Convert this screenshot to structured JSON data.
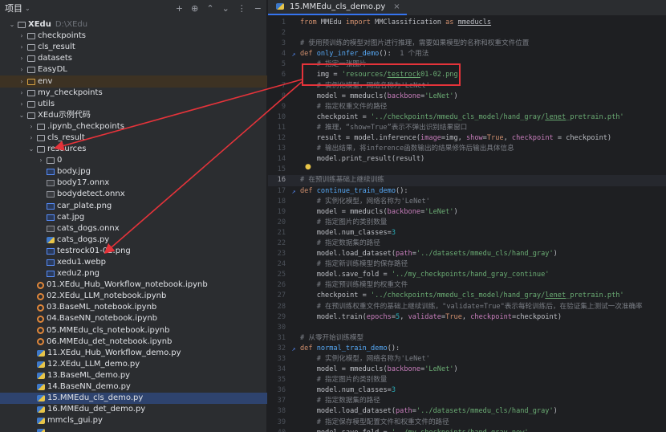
{
  "project": {
    "title": "项目",
    "tree": [
      {
        "name": "XEdu",
        "sub": "D:\\XEdu",
        "depth": 0,
        "type": "folder",
        "chev": "⌄",
        "bold": true
      },
      {
        "name": "checkpoints",
        "depth": 1,
        "type": "folder",
        "chev": "›"
      },
      {
        "name": "cls_result",
        "depth": 1,
        "type": "folder",
        "chev": "›"
      },
      {
        "name": "datasets",
        "depth": 1,
        "type": "folder",
        "chev": "›"
      },
      {
        "name": "EasyDL",
        "depth": 1,
        "type": "folder",
        "chev": "›"
      },
      {
        "name": "env",
        "depth": 1,
        "type": "folder-orange",
        "chev": "›",
        "env": true
      },
      {
        "name": "my_checkpoints",
        "depth": 1,
        "type": "folder",
        "chev": "›"
      },
      {
        "name": "utils",
        "depth": 1,
        "type": "folder",
        "chev": "›"
      },
      {
        "name": "XEdu示例代码",
        "depth": 1,
        "type": "folder",
        "chev": "⌄"
      },
      {
        "name": ".ipynb_checkpoints",
        "depth": 2,
        "type": "folder",
        "chev": "›"
      },
      {
        "name": "cls_result",
        "depth": 2,
        "type": "folder",
        "chev": "›"
      },
      {
        "name": "resources",
        "depth": 2,
        "type": "folder",
        "chev": "⌄"
      },
      {
        "name": "0",
        "depth": 3,
        "type": "folder",
        "chev": "›"
      },
      {
        "name": "body.jpg",
        "depth": 3,
        "type": "img",
        "chev": ""
      },
      {
        "name": "body17.onnx",
        "depth": 3,
        "type": "onnx",
        "chev": ""
      },
      {
        "name": "bodydetect.onnx",
        "depth": 3,
        "type": "onnx",
        "chev": ""
      },
      {
        "name": "car_plate.png",
        "depth": 3,
        "type": "img",
        "chev": ""
      },
      {
        "name": "cat.jpg",
        "depth": 3,
        "type": "img",
        "chev": ""
      },
      {
        "name": "cats_dogs.onnx",
        "depth": 3,
        "type": "onnx",
        "chev": ""
      },
      {
        "name": "cats_dogs.py",
        "depth": 3,
        "type": "py",
        "chev": ""
      },
      {
        "name": "testrock01-02.png",
        "depth": 3,
        "type": "img",
        "chev": ""
      },
      {
        "name": "xedu1.webp",
        "depth": 3,
        "type": "img",
        "chev": ""
      },
      {
        "name": "xedu2.png",
        "depth": 3,
        "type": "img",
        "chev": ""
      },
      {
        "name": "01.XEdu_Hub_Workflow_notebook.ipynb",
        "depth": 2,
        "type": "nb",
        "chev": ""
      },
      {
        "name": "02.XEdu_LLM_notebook.ipynb",
        "depth": 2,
        "type": "nb",
        "chev": ""
      },
      {
        "name": "03.BaseML_notebook.ipynb",
        "depth": 2,
        "type": "nb",
        "chev": ""
      },
      {
        "name": "04.BaseNN_notebook.ipynb",
        "depth": 2,
        "type": "nb",
        "chev": ""
      },
      {
        "name": "05.MMEdu_cls_notebook.ipynb",
        "depth": 2,
        "type": "nb",
        "chev": ""
      },
      {
        "name": "06.MMEdu_det_notebook.ipynb",
        "depth": 2,
        "type": "nb",
        "chev": ""
      },
      {
        "name": "11.XEdu_Hub_Workflow_demo.py",
        "depth": 2,
        "type": "py",
        "chev": ""
      },
      {
        "name": "12.XEdu_LLM_demo.py",
        "depth": 2,
        "type": "py",
        "chev": ""
      },
      {
        "name": "13.BaseML_demo.py",
        "depth": 2,
        "type": "py",
        "chev": ""
      },
      {
        "name": "14.BaseNN_demo.py",
        "depth": 2,
        "type": "py",
        "chev": ""
      },
      {
        "name": "15.MMEdu_cls_demo.py",
        "depth": 2,
        "type": "py",
        "chev": "",
        "selected": true
      },
      {
        "name": "16.MMEdu_det_demo.py",
        "depth": 2,
        "type": "py",
        "chev": ""
      },
      {
        "name": "mmcls_gui.py",
        "depth": 2,
        "type": "py",
        "chev": ""
      },
      {
        "name": "",
        "depth": 2,
        "type": "py",
        "chev": ""
      }
    ]
  },
  "editor": {
    "tab_label": "15.MMEdu_cls_demo.py",
    "tab_close": "×",
    "usage_hint": "1 个用法",
    "lines": [
      {
        "n": "1",
        "mark": "",
        "html": "<span class='kw'>from</span> MMEdu <span class='kw'>import</span> MMClassification <span class='kw'>as</span> <span class='u'>mmeducls</span>"
      },
      {
        "n": "2",
        "mark": "",
        "html": ""
      },
      {
        "n": "3",
        "mark": "",
        "html": "<span class='cm'># 使用预训练的模型对图片进行推理，需要如果模型的名称和权重文件位置</span>"
      },
      {
        "n": "4",
        "mark": "↗",
        "html": "<span class='kw'>def</span> <span class='fn'>only_infer_demo</span>():  <span class='hint' data-name='usage-hint' data-bind='editor.usage_hint' data-interactable='true'></span>"
      },
      {
        "n": "5",
        "mark": "",
        "html": "    <span class='cm'># 指定一张图片</span>"
      },
      {
        "n": "6",
        "mark": "",
        "html": "    img = <span class='str'>'resources/<span class=\"u\">testrock</span>01-02.png'</span>"
      },
      {
        "n": "7",
        "mark": "",
        "html": "    <span class='cm'># 实例化模型，网络名称为'LeNet'</span>"
      },
      {
        "n": "8",
        "mark": "",
        "html": "    model = mmeducls(<span class='prm'>backbone</span>=<span class='str'>'LeNet'</span>)"
      },
      {
        "n": "9",
        "mark": "",
        "html": "    <span class='cm'># 指定权重文件的路径</span>"
      },
      {
        "n": "10",
        "mark": "",
        "html": "    checkpoint = <span class='str'>'../checkpoints/mmedu_cls_model/hand_gray/<span class=\"u\">lenet</span>_pretrain.pth'</span>"
      },
      {
        "n": "11",
        "mark": "",
        "html": "    <span class='cm'># 推理，“show=True”表示不弹出识别结果窗口</span>"
      },
      {
        "n": "12",
        "mark": "",
        "html": "    result = model.inference(<span class='prm'>image</span>=img, <span class='prm'>show</span>=<span class='kw'>True</span>, <span class='prm'>checkpoint</span> = checkpoint)"
      },
      {
        "n": "13",
        "mark": "",
        "html": "    <span class='cm'># 输出结果，将inference函数输出的结果修饰后输出具体信息</span>"
      },
      {
        "n": "14",
        "mark": "",
        "html": "    model.print_result(result)"
      },
      {
        "n": "15",
        "mark": "",
        "html": ""
      },
      {
        "n": "16",
        "mark": "",
        "html": "<span class='cm'># 在预训练基础上继续训练</span>",
        "cur": true
      },
      {
        "n": "17",
        "mark": "↗",
        "html": "<span class='kw'>def</span> <span class='fn'>continue_train_demo</span>():"
      },
      {
        "n": "18",
        "mark": "",
        "html": "    <span class='cm'># 实例化模型，网络名称为'LeNet'</span>"
      },
      {
        "n": "19",
        "mark": "",
        "html": "    model = mmeducls(<span class='prm'>backbone</span>=<span class='str'>'LeNet'</span>)"
      },
      {
        "n": "20",
        "mark": "",
        "html": "    <span class='cm'># 指定图片的类别数量</span>"
      },
      {
        "n": "21",
        "mark": "",
        "html": "    model.num_classes=<span class='num'>3</span>"
      },
      {
        "n": "22",
        "mark": "",
        "html": "    <span class='cm'># 指定数据集的路径</span>"
      },
      {
        "n": "23",
        "mark": "",
        "html": "    model.load_dataset(<span class='prm'>path</span>=<span class='str'>'../datasets/mmedu_cls/hand_gray'</span>)"
      },
      {
        "n": "24",
        "mark": "",
        "html": "    <span class='cm'># 指定新训练模型的保存路径</span>"
      },
      {
        "n": "25",
        "mark": "",
        "html": "    model.save_fold = <span class='str'>'../my_checkpoints/hand_gray_continue'</span>"
      },
      {
        "n": "26",
        "mark": "",
        "html": "    <span class='cm'># 指定预训练模型的权重文件</span>"
      },
      {
        "n": "27",
        "mark": "",
        "html": "    checkpoint = <span class='str'>'../checkpoints/mmedu_cls_model/hand_gray/<span class=\"u\">lenet</span>_pretrain.pth'</span>"
      },
      {
        "n": "28",
        "mark": "",
        "html": "    <span class='cm'># 在预训练权重文件的基础上继续训练，\"validate=True\"表示每轮训练后，在验证集上测试一次准确率</span>"
      },
      {
        "n": "29",
        "mark": "",
        "html": "    model.train(<span class='prm'>epochs</span>=<span class='num'>5</span>, <span class='prm'>validate</span>=<span class='kw'>True</span>, <span class='prm'>checkpoint</span>=checkpoint)"
      },
      {
        "n": "30",
        "mark": "",
        "html": ""
      },
      {
        "n": "31",
        "mark": "",
        "html": "<span class='cm'># 从零开始训练模型</span>"
      },
      {
        "n": "32",
        "mark": "↗",
        "html": "<span class='kw'>def</span> <span class='fn'>normal_train_demo</span>():"
      },
      {
        "n": "33",
        "mark": "",
        "html": "    <span class='cm'># 实例化模型，网络名称为'LeNet'</span>"
      },
      {
        "n": "34",
        "mark": "",
        "html": "    model = mmeducls(<span class='prm'>backbone</span>=<span class='str'>'LeNet'</span>)"
      },
      {
        "n": "35",
        "mark": "",
        "html": "    <span class='cm'># 指定图片的类别数量</span>"
      },
      {
        "n": "36",
        "mark": "",
        "html": "    model.num_classes=<span class='num'>3</span>"
      },
      {
        "n": "37",
        "mark": "",
        "html": "    <span class='cm'># 指定数据集的路径</span>"
      },
      {
        "n": "38",
        "mark": "",
        "html": "    model.load_dataset(<span class='prm'>path</span>=<span class='str'>'../datasets/mmedu_cls/hand_gray'</span>)"
      },
      {
        "n": "39",
        "mark": "",
        "html": "    <span class='cm'># 指定保存模型配置文件和权重文件的路径</span>"
      },
      {
        "n": "40",
        "mark": "",
        "html": "    model.save_fold = <span class='str'>'../my_checkpoints/hand_gray_new'</span>"
      }
    ]
  },
  "annotation_color": "#e5333a"
}
